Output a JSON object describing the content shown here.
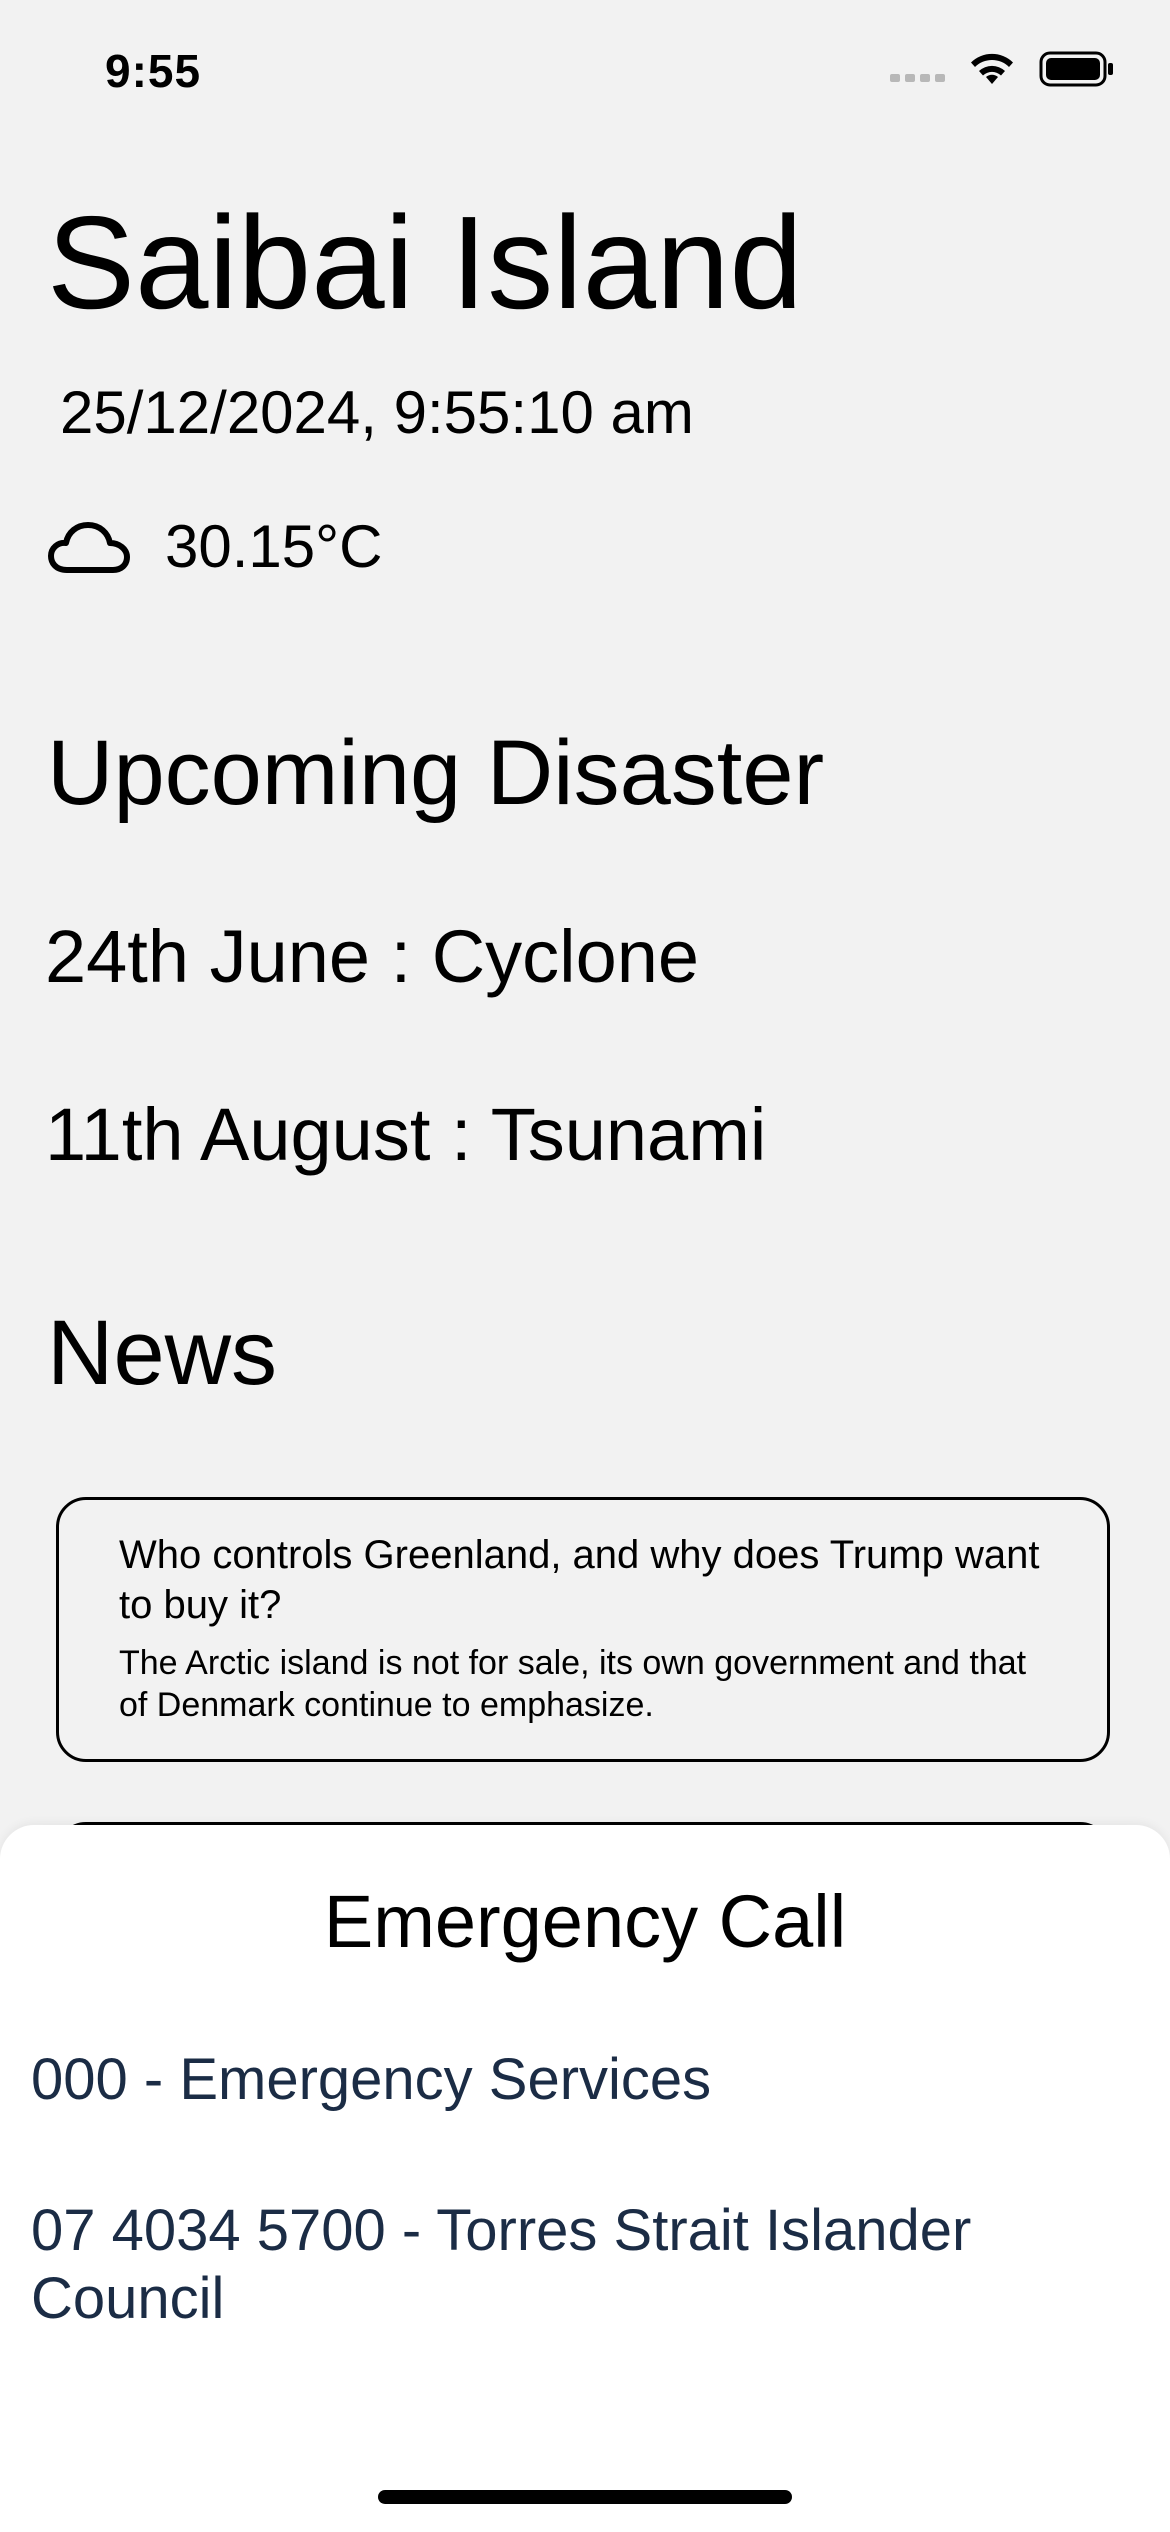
{
  "status_bar": {
    "time": "9:55"
  },
  "location": {
    "name": "Saibai Island",
    "datetime": "25/12/2024, 9:55:10 am",
    "weather_icon": "cloud-icon",
    "temperature": "30.15°C"
  },
  "disasters": {
    "heading": "Upcoming Disaster",
    "items": [
      "24th June : Cyclone",
      "11th August : Tsunami"
    ]
  },
  "news": {
    "heading": "News",
    "articles": [
      {
        "headline": "Who controls Greenland, and why does Trump want to buy it?",
        "summary": "The Arctic island is not for sale, its own government and that of Denmark continue to emphasize."
      }
    ]
  },
  "emergency": {
    "title": "Emergency Call",
    "contacts": [
      "000 - Emergency Services",
      "07 4034 5700 - Torres Strait Islander Council"
    ],
    "link_color": "#1b2c45"
  }
}
